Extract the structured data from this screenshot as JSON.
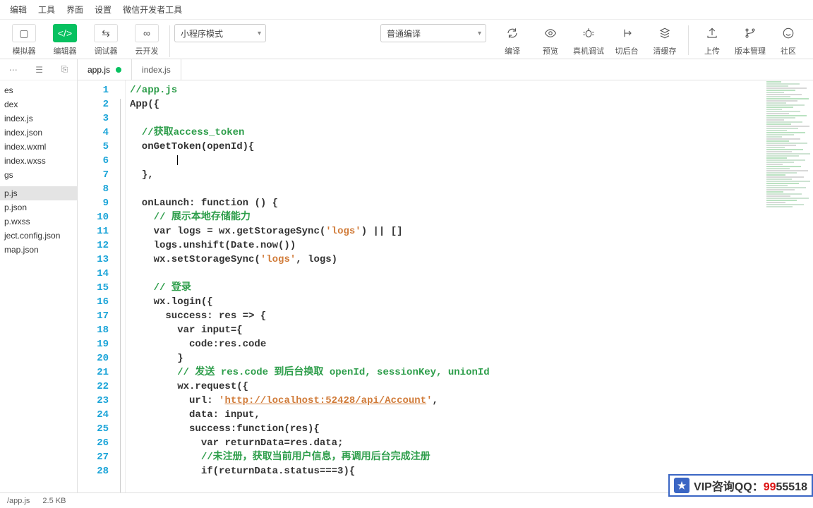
{
  "menu": {
    "items": [
      "编辑",
      "工具",
      "界面",
      "设置",
      "微信开发者工具"
    ]
  },
  "toolbar_left": [
    {
      "label": "模拟器",
      "glyph": "▢",
      "name": "simulator-button"
    },
    {
      "label": "编辑器",
      "glyph": "</>",
      "name": "editor-button",
      "active": true
    },
    {
      "label": "调试器",
      "glyph": "⇆",
      "name": "debugger-button"
    },
    {
      "label": "云开发",
      "glyph": "∞",
      "name": "cloud-button"
    }
  ],
  "combo_mode": "小程序模式",
  "combo_compile": "普通编译",
  "toolbar_right": [
    {
      "label": "编译",
      "name": "compile-button",
      "icon": "refresh"
    },
    {
      "label": "预览",
      "name": "preview-button",
      "icon": "eye"
    },
    {
      "label": "真机调试",
      "name": "remote-debug-button",
      "icon": "bug"
    },
    {
      "label": "切后台",
      "name": "background-button",
      "icon": "back"
    },
    {
      "label": "清缓存",
      "name": "clear-cache-button",
      "icon": "stack"
    },
    {
      "label": "上传",
      "name": "upload-button",
      "icon": "upload"
    },
    {
      "label": "版本管理",
      "name": "version-button",
      "icon": "branch"
    },
    {
      "label": "社区",
      "name": "community-button",
      "icon": "smile"
    }
  ],
  "sidebar": {
    "files": [
      "es",
      "dex",
      "index.js",
      "index.json",
      "index.wxml",
      "index.wxss",
      "gs",
      "",
      "p.js",
      "p.json",
      "p.wxss",
      "ject.config.json",
      "map.json"
    ],
    "selected": 8
  },
  "tabs": [
    {
      "label": "app.js",
      "modified": true,
      "active": true
    },
    {
      "label": "index.js",
      "modified": false,
      "active": false
    }
  ],
  "code_lines": [
    [
      {
        "c": "c-comment",
        "t": "//app.js"
      }
    ],
    [
      {
        "c": "c-normal",
        "t": "App({"
      }
    ],
    [],
    [
      {
        "c": "c-normal",
        "t": "  "
      },
      {
        "c": "c-comment",
        "t": "//获取access_token"
      }
    ],
    [
      {
        "c": "c-normal",
        "t": "  onGetToken(openId){"
      }
    ],
    [
      {
        "c": "c-normal",
        "t": "        "
      },
      {
        "cursor": true
      }
    ],
    [
      {
        "c": "c-normal",
        "t": "  },"
      }
    ],
    [],
    [
      {
        "c": "c-normal",
        "t": "  onLaunch: "
      },
      {
        "c": "c-kw",
        "t": "function"
      },
      {
        "c": "c-normal",
        "t": " () {"
      }
    ],
    [
      {
        "c": "c-normal",
        "t": "    "
      },
      {
        "c": "c-comment",
        "t": "// 展示本地存储能力"
      }
    ],
    [
      {
        "c": "c-normal",
        "t": "    "
      },
      {
        "c": "c-kw",
        "t": "var"
      },
      {
        "c": "c-normal",
        "t": " logs = wx.getStorageSync("
      },
      {
        "c": "c-str",
        "t": "'logs'"
      },
      {
        "c": "c-normal",
        "t": ") || []"
      }
    ],
    [
      {
        "c": "c-normal",
        "t": "    logs.unshift(Date.now())"
      }
    ],
    [
      {
        "c": "c-normal",
        "t": "    wx.setStorageSync("
      },
      {
        "c": "c-str",
        "t": "'logs'"
      },
      {
        "c": "c-normal",
        "t": ", logs)"
      }
    ],
    [],
    [
      {
        "c": "c-normal",
        "t": "    "
      },
      {
        "c": "c-comment",
        "t": "// 登录"
      }
    ],
    [
      {
        "c": "c-normal",
        "t": "    wx.login({"
      }
    ],
    [
      {
        "c": "c-normal",
        "t": "      success: res => {"
      }
    ],
    [
      {
        "c": "c-normal",
        "t": "        "
      },
      {
        "c": "c-kw",
        "t": "var"
      },
      {
        "c": "c-normal",
        "t": " input={"
      }
    ],
    [
      {
        "c": "c-normal",
        "t": "          code:res.code"
      }
    ],
    [
      {
        "c": "c-normal",
        "t": "        }"
      }
    ],
    [
      {
        "c": "c-normal",
        "t": "        "
      },
      {
        "c": "c-comment",
        "t": "// 发送 res.code 到后台换取 openId, sessionKey, unionId"
      }
    ],
    [
      {
        "c": "c-normal",
        "t": "        wx.request({"
      }
    ],
    [
      {
        "c": "c-normal",
        "t": "          url: "
      },
      {
        "c": "c-str",
        "t": "'"
      },
      {
        "c": "c-link",
        "t": "http://localhost:52428/api/Account"
      },
      {
        "c": "c-str",
        "t": "'"
      },
      {
        "c": "c-normal",
        "t": ","
      }
    ],
    [
      {
        "c": "c-normal",
        "t": "          data: input,"
      }
    ],
    [
      {
        "c": "c-normal",
        "t": "          success:"
      },
      {
        "c": "c-kw",
        "t": "function"
      },
      {
        "c": "c-normal",
        "t": "(res){"
      }
    ],
    [
      {
        "c": "c-normal",
        "t": "            "
      },
      {
        "c": "c-kw",
        "t": "var"
      },
      {
        "c": "c-normal",
        "t": " returnData=res.data;"
      }
    ],
    [
      {
        "c": "c-normal",
        "t": "            "
      },
      {
        "c": "c-comment",
        "t": "//未注册，获取当前用户信息，再调用后台完成注册"
      }
    ],
    [
      {
        "c": "c-normal",
        "t": "            if(returnData.status===3){"
      }
    ]
  ],
  "status": {
    "path": "/app.js",
    "size": "2.5 KB"
  },
  "watermark": {
    "prefix": "VIP咨询QQ：",
    "highlight": "99",
    "suffix": "55518"
  }
}
